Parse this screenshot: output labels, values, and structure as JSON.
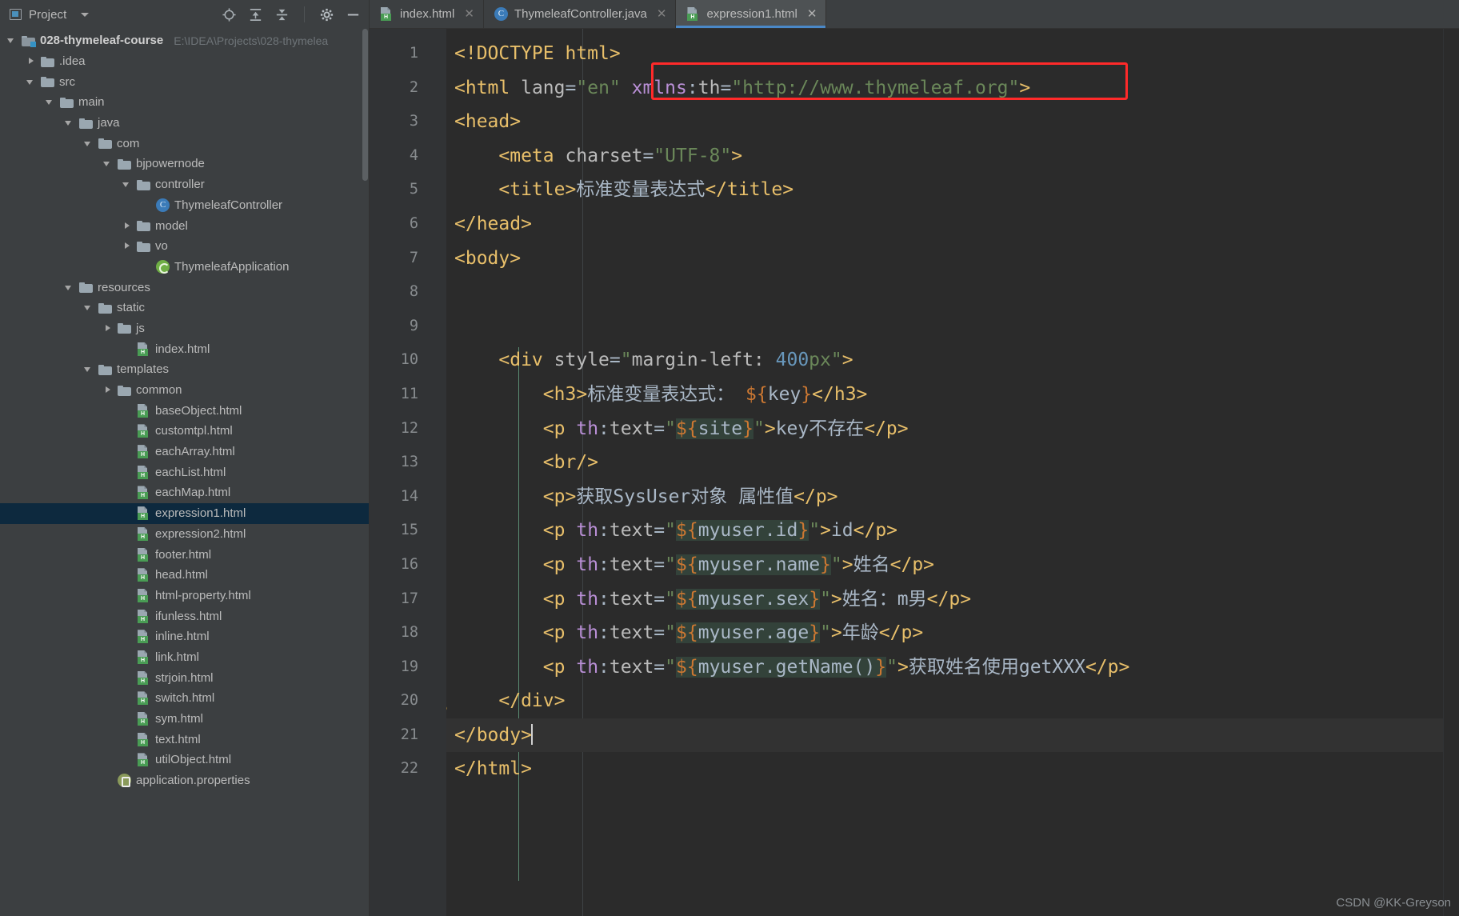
{
  "window": {
    "project_panel_title": "Project",
    "watermark": "CSDN @KK-Greyson"
  },
  "toolbar": {
    "icons": [
      {
        "name": "locate-icon",
        "label": "⊕"
      },
      {
        "name": "expand-all-icon",
        "label": "≡"
      },
      {
        "name": "collapse-all-icon",
        "label": "≡"
      },
      {
        "name": "settings-gear-icon",
        "label": "⚙"
      },
      {
        "name": "hide-icon",
        "label": "—"
      }
    ]
  },
  "tabs": [
    {
      "label": "index.html",
      "icon": "html-file-icon",
      "badge": "H",
      "active": false,
      "close": "✕"
    },
    {
      "label": "ThymeleafController.java",
      "icon": "java-class-icon",
      "badge": "C",
      "active": false,
      "close": "✕"
    },
    {
      "label": "expression1.html",
      "icon": "html-file-icon",
      "badge": "H",
      "active": true,
      "close": "✕"
    }
  ],
  "tree": [
    {
      "indent": 0,
      "arrow": "down",
      "icon": "module-folder-icon",
      "label": "028-thymeleaf-course",
      "bold": true,
      "path": "E:\\IDEA\\Projects\\028-thymelea",
      "selected": false
    },
    {
      "indent": 1,
      "arrow": "right",
      "icon": "folder-icon",
      "label": ".idea",
      "bold": false,
      "path": "",
      "selected": false
    },
    {
      "indent": 1,
      "arrow": "down",
      "icon": "folder-icon",
      "label": "src",
      "bold": false,
      "path": "",
      "selected": false
    },
    {
      "indent": 2,
      "arrow": "down",
      "icon": "folder-icon",
      "label": "main",
      "bold": false,
      "path": "",
      "selected": false
    },
    {
      "indent": 3,
      "arrow": "down",
      "icon": "folder-icon",
      "label": "java",
      "bold": false,
      "path": "",
      "selected": false
    },
    {
      "indent": 4,
      "arrow": "down",
      "icon": "package-icon",
      "label": "com",
      "bold": false,
      "path": "",
      "selected": false
    },
    {
      "indent": 5,
      "arrow": "down",
      "icon": "package-icon",
      "label": "bjpowernode",
      "bold": false,
      "path": "",
      "selected": false
    },
    {
      "indent": 6,
      "arrow": "down",
      "icon": "package-icon",
      "label": "controller",
      "bold": false,
      "path": "",
      "selected": false
    },
    {
      "indent": 7,
      "arrow": "none",
      "icon": "java-class-icon",
      "label": "ThymeleafController",
      "bold": false,
      "path": "",
      "selected": false
    },
    {
      "indent": 6,
      "arrow": "right",
      "icon": "package-icon",
      "label": "model",
      "bold": false,
      "path": "",
      "selected": false
    },
    {
      "indent": 6,
      "arrow": "right",
      "icon": "package-icon",
      "label": "vo",
      "bold": false,
      "path": "",
      "selected": false
    },
    {
      "indent": 7,
      "arrow": "none",
      "icon": "spring-boot-icon",
      "label": "ThymeleafApplication",
      "bold": false,
      "path": "",
      "selected": false
    },
    {
      "indent": 3,
      "arrow": "down",
      "icon": "resources-folder-icon",
      "label": "resources",
      "bold": false,
      "path": "",
      "selected": false
    },
    {
      "indent": 4,
      "arrow": "down",
      "icon": "folder-icon",
      "label": "static",
      "bold": false,
      "path": "",
      "selected": false
    },
    {
      "indent": 5,
      "arrow": "right",
      "icon": "folder-icon",
      "label": "js",
      "bold": false,
      "path": "",
      "selected": false
    },
    {
      "indent": 6,
      "arrow": "none",
      "icon": "html-file-icon",
      "label": "index.html",
      "bold": false,
      "path": "",
      "selected": false
    },
    {
      "indent": 4,
      "arrow": "down",
      "icon": "folder-icon",
      "label": "templates",
      "bold": false,
      "path": "",
      "selected": false
    },
    {
      "indent": 5,
      "arrow": "right",
      "icon": "folder-icon",
      "label": "common",
      "bold": false,
      "path": "",
      "selected": false
    },
    {
      "indent": 6,
      "arrow": "none",
      "icon": "html-file-icon",
      "label": "baseObject.html",
      "bold": false,
      "path": "",
      "selected": false
    },
    {
      "indent": 6,
      "arrow": "none",
      "icon": "html-file-icon",
      "label": "customtpl.html",
      "bold": false,
      "path": "",
      "selected": false
    },
    {
      "indent": 6,
      "arrow": "none",
      "icon": "html-file-icon",
      "label": "eachArray.html",
      "bold": false,
      "path": "",
      "selected": false
    },
    {
      "indent": 6,
      "arrow": "none",
      "icon": "html-file-icon",
      "label": "eachList.html",
      "bold": false,
      "path": "",
      "selected": false
    },
    {
      "indent": 6,
      "arrow": "none",
      "icon": "html-file-icon",
      "label": "eachMap.html",
      "bold": false,
      "path": "",
      "selected": false
    },
    {
      "indent": 6,
      "arrow": "none",
      "icon": "html-file-icon",
      "label": "expression1.html",
      "bold": false,
      "path": "",
      "selected": true
    },
    {
      "indent": 6,
      "arrow": "none",
      "icon": "html-file-icon",
      "label": "expression2.html",
      "bold": false,
      "path": "",
      "selected": false
    },
    {
      "indent": 6,
      "arrow": "none",
      "icon": "html-file-icon",
      "label": "footer.html",
      "bold": false,
      "path": "",
      "selected": false
    },
    {
      "indent": 6,
      "arrow": "none",
      "icon": "html-file-icon",
      "label": "head.html",
      "bold": false,
      "path": "",
      "selected": false
    },
    {
      "indent": 6,
      "arrow": "none",
      "icon": "html-file-icon",
      "label": "html-property.html",
      "bold": false,
      "path": "",
      "selected": false
    },
    {
      "indent": 6,
      "arrow": "none",
      "icon": "html-file-icon",
      "label": "ifunless.html",
      "bold": false,
      "path": "",
      "selected": false
    },
    {
      "indent": 6,
      "arrow": "none",
      "icon": "html-file-icon",
      "label": "inline.html",
      "bold": false,
      "path": "",
      "selected": false
    },
    {
      "indent": 6,
      "arrow": "none",
      "icon": "html-file-icon",
      "label": "link.html",
      "bold": false,
      "path": "",
      "selected": false
    },
    {
      "indent": 6,
      "arrow": "none",
      "icon": "html-file-icon",
      "label": "strjoin.html",
      "bold": false,
      "path": "",
      "selected": false
    },
    {
      "indent": 6,
      "arrow": "none",
      "icon": "html-file-icon",
      "label": "switch.html",
      "bold": false,
      "path": "",
      "selected": false
    },
    {
      "indent": 6,
      "arrow": "none",
      "icon": "html-file-icon",
      "label": "sym.html",
      "bold": false,
      "path": "",
      "selected": false
    },
    {
      "indent": 6,
      "arrow": "none",
      "icon": "html-file-icon",
      "label": "text.html",
      "bold": false,
      "path": "",
      "selected": false
    },
    {
      "indent": 6,
      "arrow": "none",
      "icon": "html-file-icon",
      "label": "utilObject.html",
      "bold": false,
      "path": "",
      "selected": false
    },
    {
      "indent": 5,
      "arrow": "none",
      "icon": "properties-file-icon",
      "label": "application.properties",
      "bold": false,
      "path": "",
      "selected": false
    }
  ],
  "editor": {
    "line_numbers": [
      1,
      2,
      3,
      4,
      5,
      6,
      7,
      8,
      9,
      10,
      11,
      12,
      13,
      14,
      15,
      16,
      17,
      18,
      19,
      20,
      21,
      22
    ],
    "current_line": 21,
    "caret_line": 21,
    "annotation_box": {
      "color": "#ff2a2a",
      "around_line": 2,
      "text": "xmlns:th=\"http://www.thymeleaf.org\""
    },
    "lines": [
      {
        "n": 1,
        "fold": "",
        "indent": 0,
        "text": "<!DOCTYPE html>"
      },
      {
        "n": 2,
        "fold": "open",
        "indent": 0,
        "text": "<html lang=\"en\" xmlns:th=\"http://www.thymeleaf.org\">"
      },
      {
        "n": 3,
        "fold": "open",
        "indent": 0,
        "text": "<head>"
      },
      {
        "n": 4,
        "fold": "",
        "indent": 1,
        "text": "<meta charset=\"UTF-8\">"
      },
      {
        "n": 5,
        "fold": "",
        "indent": 1,
        "text": "<title>标准变量表达式</title>"
      },
      {
        "n": 6,
        "fold": "close",
        "indent": 0,
        "text": "</head>"
      },
      {
        "n": 7,
        "fold": "open",
        "indent": 0,
        "text": "<body>"
      },
      {
        "n": 8,
        "fold": "",
        "indent": 0,
        "text": ""
      },
      {
        "n": 9,
        "fold": "",
        "indent": 0,
        "text": ""
      },
      {
        "n": 10,
        "fold": "open",
        "indent": 1,
        "text": "<div style=\"margin-left: 400px\">"
      },
      {
        "n": 11,
        "fold": "",
        "indent": 2,
        "text": "<h3>标准变量表达式： ${key}</h3>"
      },
      {
        "n": 12,
        "fold": "",
        "indent": 2,
        "text": "<p th:text=\"${site}\">key不存在</p>"
      },
      {
        "n": 13,
        "fold": "",
        "indent": 2,
        "text": "<br/>"
      },
      {
        "n": 14,
        "fold": "",
        "indent": 2,
        "text": "<p>获取SysUser对象 属性值</p>"
      },
      {
        "n": 15,
        "fold": "",
        "indent": 2,
        "text": "<p th:text=\"${myuser.id}\">id</p>"
      },
      {
        "n": 16,
        "fold": "",
        "indent": 2,
        "text": "<p th:text=\"${myuser.name}\">姓名</p>"
      },
      {
        "n": 17,
        "fold": "",
        "indent": 2,
        "text": "<p th:text=\"${myuser.sex}\">姓名：m男</p>"
      },
      {
        "n": 18,
        "fold": "",
        "indent": 2,
        "text": "<p th:text=\"${myuser.age}\">年龄</p>"
      },
      {
        "n": 19,
        "fold": "",
        "indent": 2,
        "text": "<p th:text=\"${myuser.getName()}\">获取姓名使用getXXX</p>"
      },
      {
        "n": 20,
        "fold": "close",
        "indent": 1,
        "text": "</div>",
        "bulb": true
      },
      {
        "n": 21,
        "fold": "close",
        "indent": 0,
        "text": "</body>",
        "current": true
      },
      {
        "n": 22,
        "fold": "",
        "indent": 0,
        "text": "</html>"
      }
    ]
  },
  "colors": {
    "tag": "#e8bf6a",
    "attribute": "#bababa",
    "namespace": "#b98fd6",
    "string": "#6a8759",
    "number": "#6897bb",
    "text": "#a9b7c6",
    "brace": "#cc7832",
    "expression_background": "#33423a",
    "editor_background": "#2b2b2b",
    "gutter_background": "#313335",
    "panel_background": "#3c3f41",
    "selection": "#0d293e",
    "tab_active_underline": "#4a88c7",
    "annotation": "#ff2a2a"
  }
}
